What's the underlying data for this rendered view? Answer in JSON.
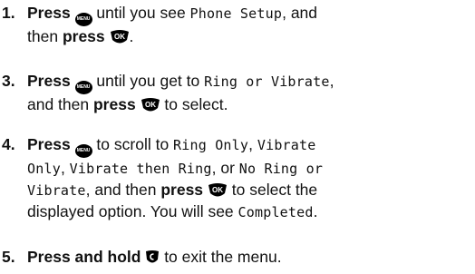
{
  "steps": [
    {
      "number": "1.",
      "parts": [
        {
          "t": "b",
          "v": "Press"
        },
        {
          "t": " "
        },
        {
          "t": "menu"
        },
        {
          "t": "x",
          "v": " until you see "
        },
        {
          "t": "lcd",
          "v": "Phone Setup"
        },
        {
          "t": "x",
          "v": ", and"
        },
        {
          "t": "br"
        },
        {
          "t": "x",
          "v": "then "
        },
        {
          "t": "b",
          "v": "press"
        },
        {
          "t": " "
        },
        {
          "t": "ok"
        },
        {
          "t": "x",
          "v": "."
        }
      ]
    },
    {
      "number": "3.",
      "parts": [
        {
          "t": "b",
          "v": "Press"
        },
        {
          "t": " "
        },
        {
          "t": "menu"
        },
        {
          "t": "x",
          "v": " until you get to "
        },
        {
          "t": "lcd",
          "v": "Ring or Vibrate"
        },
        {
          "t": "x",
          "v": ","
        },
        {
          "t": "br"
        },
        {
          "t": "x",
          "v": "and then "
        },
        {
          "t": "b",
          "v": "press"
        },
        {
          "t": " "
        },
        {
          "t": "ok"
        },
        {
          "t": "x",
          "v": " to select."
        }
      ]
    },
    {
      "number": "4.",
      "parts": [
        {
          "t": "b",
          "v": "Press"
        },
        {
          "t": " "
        },
        {
          "t": "menu"
        },
        {
          "t": "x",
          "v": " to scroll to "
        },
        {
          "t": "lcd",
          "v": "Ring Only"
        },
        {
          "t": "x",
          "v": ", "
        },
        {
          "t": "lcd",
          "v": "Vibrate"
        },
        {
          "t": "br"
        },
        {
          "t": "lcd",
          "v": "Only"
        },
        {
          "t": "x",
          "v": ", "
        },
        {
          "t": "lcd",
          "v": "Vibrate then Ring"
        },
        {
          "t": "x",
          "v": ", or "
        },
        {
          "t": "lcd",
          "v": "No Ring or"
        },
        {
          "t": "br"
        },
        {
          "t": "lcd",
          "v": "Vibrate"
        },
        {
          "t": "x",
          "v": ", and then "
        },
        {
          "t": "b",
          "v": "press"
        },
        {
          "t": " "
        },
        {
          "t": "ok"
        },
        {
          "t": "x",
          "v": " to select the"
        },
        {
          "t": "br"
        },
        {
          "t": "x",
          "v": "displayed option. You will see "
        },
        {
          "t": "lcd",
          "v": "Completed"
        },
        {
          "t": "x",
          "v": "."
        }
      ]
    },
    {
      "number": "5.",
      "parts": [
        {
          "t": "b",
          "v": "Press and hold"
        },
        {
          "t": " "
        },
        {
          "t": "end"
        },
        {
          "t": "x",
          "v": " to exit the menu."
        }
      ]
    }
  ],
  "icons": {
    "menu_label": "MENU",
    "ok_label": "OK"
  }
}
